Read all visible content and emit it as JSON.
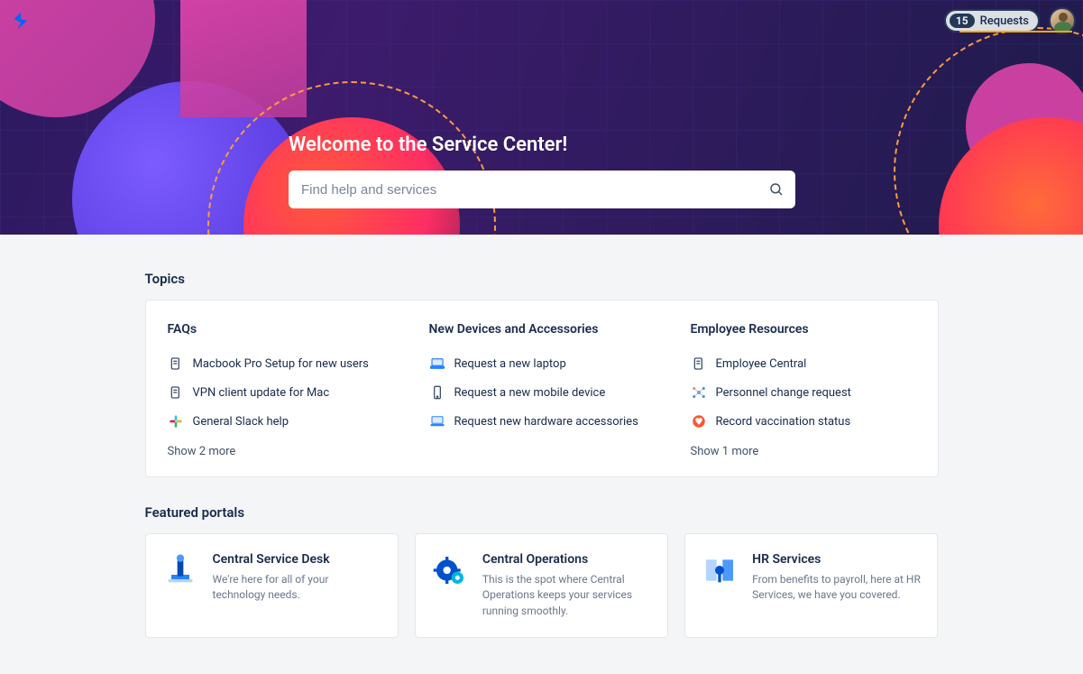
{
  "header": {
    "requests_count": "15",
    "requests_label": "Requests"
  },
  "hero": {
    "title": "Welcome to the Service Center!",
    "search_placeholder": "Find help and services"
  },
  "topics": {
    "section_label": "Topics",
    "columns": [
      {
        "title": "FAQs",
        "items": [
          {
            "label": "Macbook Pro Setup for new users",
            "icon": "doc"
          },
          {
            "label": "VPN client update for Mac",
            "icon": "doc"
          },
          {
            "label": "General Slack help",
            "icon": "slack"
          }
        ],
        "show_more": "Show 2 more"
      },
      {
        "title": "New Devices and Accessories",
        "items": [
          {
            "label": "Request a new laptop",
            "icon": "laptop"
          },
          {
            "label": "Request a new mobile device",
            "icon": "phone"
          },
          {
            "label": "Request new hardware accessories",
            "icon": "laptop"
          }
        ],
        "show_more": ""
      },
      {
        "title": "Employee Resources",
        "items": [
          {
            "label": "Employee Central",
            "icon": "doc"
          },
          {
            "label": "Personnel change request",
            "icon": "network"
          },
          {
            "label": "Record vaccination status",
            "icon": "heart"
          }
        ],
        "show_more": "Show 1 more"
      }
    ]
  },
  "portals": {
    "section_label": "Featured portals",
    "cards": [
      {
        "title": "Central Service Desk",
        "desc": "We're here for all of your technology needs.",
        "icon": "desk"
      },
      {
        "title": "Central Operations",
        "desc": "This is the spot where Central Operations keeps your services running smoothly.",
        "icon": "gear"
      },
      {
        "title": "HR Services",
        "desc": "From benefits to payroll, here at HR Services, we have you covered.",
        "icon": "hr"
      }
    ]
  }
}
